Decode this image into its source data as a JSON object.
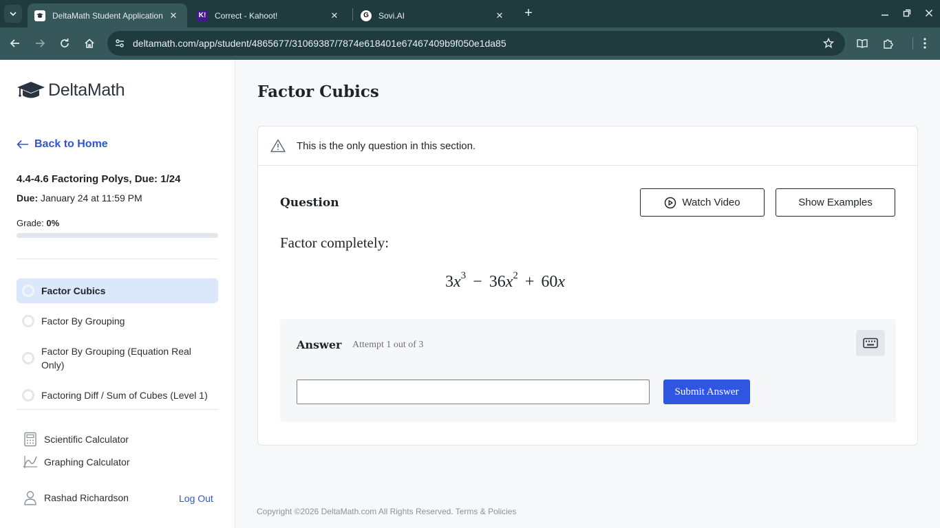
{
  "browser": {
    "tabs": [
      {
        "title": "DeltaMath Student Application",
        "active": true,
        "favicon": "deltamath-favicon"
      },
      {
        "title": "Correct - Kahoot!",
        "active": false,
        "favicon": "kahoot-favicon",
        "favicon_text": "K!"
      },
      {
        "title": "Sovi.AI",
        "active": false,
        "favicon": "sovi-favicon",
        "favicon_text": "G"
      }
    ],
    "url": "deltamath.com/app/student/4865677/31069387/7874e618401e67467409b9f050e1da85",
    "chrome_colors": {
      "tabbar": "#1f3b3e",
      "toolbar": "#36585a"
    }
  },
  "sidebar": {
    "logo_text": "DeltaMath",
    "back_label": "Back to Home",
    "assignment_title": "4.4-4.6 Factoring Polys, Due: 1/24",
    "due_label": "Due:",
    "due_value": "January 24 at 11:59 PM",
    "grade_label": "Grade:",
    "grade_value": "0%",
    "grade_progress": 0,
    "problems": [
      {
        "label": "Factor Cubics",
        "active": true
      },
      {
        "label": "Factor By Grouping",
        "active": false
      },
      {
        "label": "Factor By Grouping (Equation Real Only)",
        "active": false
      },
      {
        "label": "Factoring Diff / Sum of Cubes (Level 1)",
        "active": false
      }
    ],
    "tools": [
      {
        "label": "Scientific Calculator",
        "icon": "calculator-icon"
      },
      {
        "label": "Graphing Calculator",
        "icon": "graph-icon"
      }
    ],
    "user_name": "Rashad Richardson",
    "logout_label": "Log Out"
  },
  "main": {
    "page_title": "Factor Cubics",
    "notice_text": "This is the only question in this section.",
    "question_label": "Question",
    "watch_video_label": "Watch Video",
    "show_examples_label": "Show Examples",
    "prompt": "Factor completely:",
    "expression": {
      "c1": "3",
      "v1": "x",
      "e1": "3",
      "op1": "−",
      "c2": "36",
      "v2": "x",
      "e2": "2",
      "op2": "+",
      "c3": "60",
      "v3": "x"
    },
    "answer_label": "Answer",
    "attempt_text": "Attempt 1 out of 3",
    "answer_value": "",
    "submit_label": "Submit Answer",
    "footer_text": "Copyright ©2026 DeltaMath.com All Rights Reserved. Terms & Policies"
  },
  "colors": {
    "accent_blue": "#2f56c9",
    "submit_blue": "#2f56e0",
    "active_row": "#dbe7fb"
  }
}
